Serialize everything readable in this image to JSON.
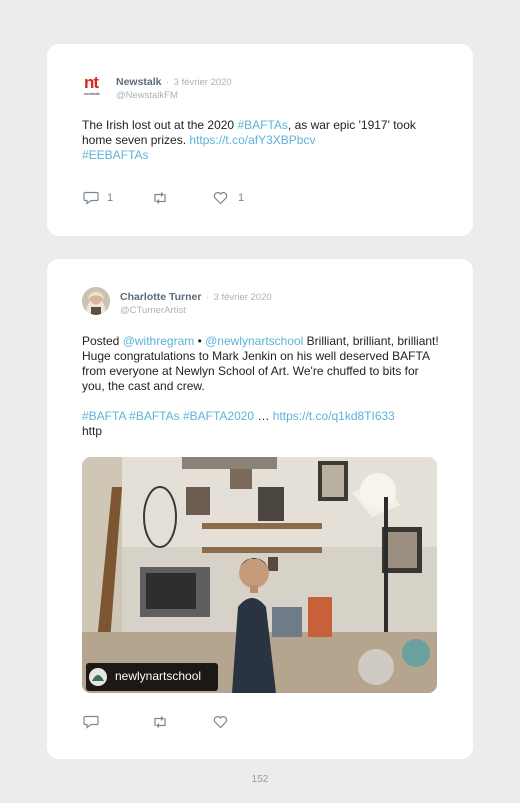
{
  "tweets": [
    {
      "author": "Newstalk",
      "dot": "·",
      "date": "3 février 2020",
      "handle": "@NewstalkFM",
      "logo_text": "nt",
      "logo_sub": "newstalk",
      "text": {
        "p1": "The Irish lost out at the 2020 ",
        "tag1": "#BAFTAs",
        "p2": ", as war epic '1917' took home seven prizes. ",
        "url": "https://t.co/afY3XBPbcv",
        "tag2": "#EEBAFTAs"
      },
      "reply_count": "1",
      "like_count": "1"
    },
    {
      "author": "Charlotte Turner",
      "dot": "·",
      "date": "3 février 2020",
      "handle": "@CTurnerArtist",
      "text": {
        "posted": "Posted ",
        "mention1": "@withregram",
        "bullet": " • ",
        "mention2": "@newlynartschool",
        "body": " Brilliant, brilliant, brilliant! Huge congratulations to Mark Jenkin on his well deserved BAFTA from everyone at Newlyn School of Art. We're chuffed to bits for you, the cast and crew.",
        "tag1": "#BAFTA",
        "tag2": "#BAFTAs",
        "tag3": "#BAFTA2020",
        "ellipsis": " … ",
        "url": "https://t.co/q1kd8TI633",
        "tail": "http"
      },
      "photo_caption": "newlynartschool"
    }
  ],
  "page_number": "152",
  "colors": {
    "link": "#5bb4d8",
    "logo_red": "#d52b1e",
    "name": "#5b6b7a"
  }
}
